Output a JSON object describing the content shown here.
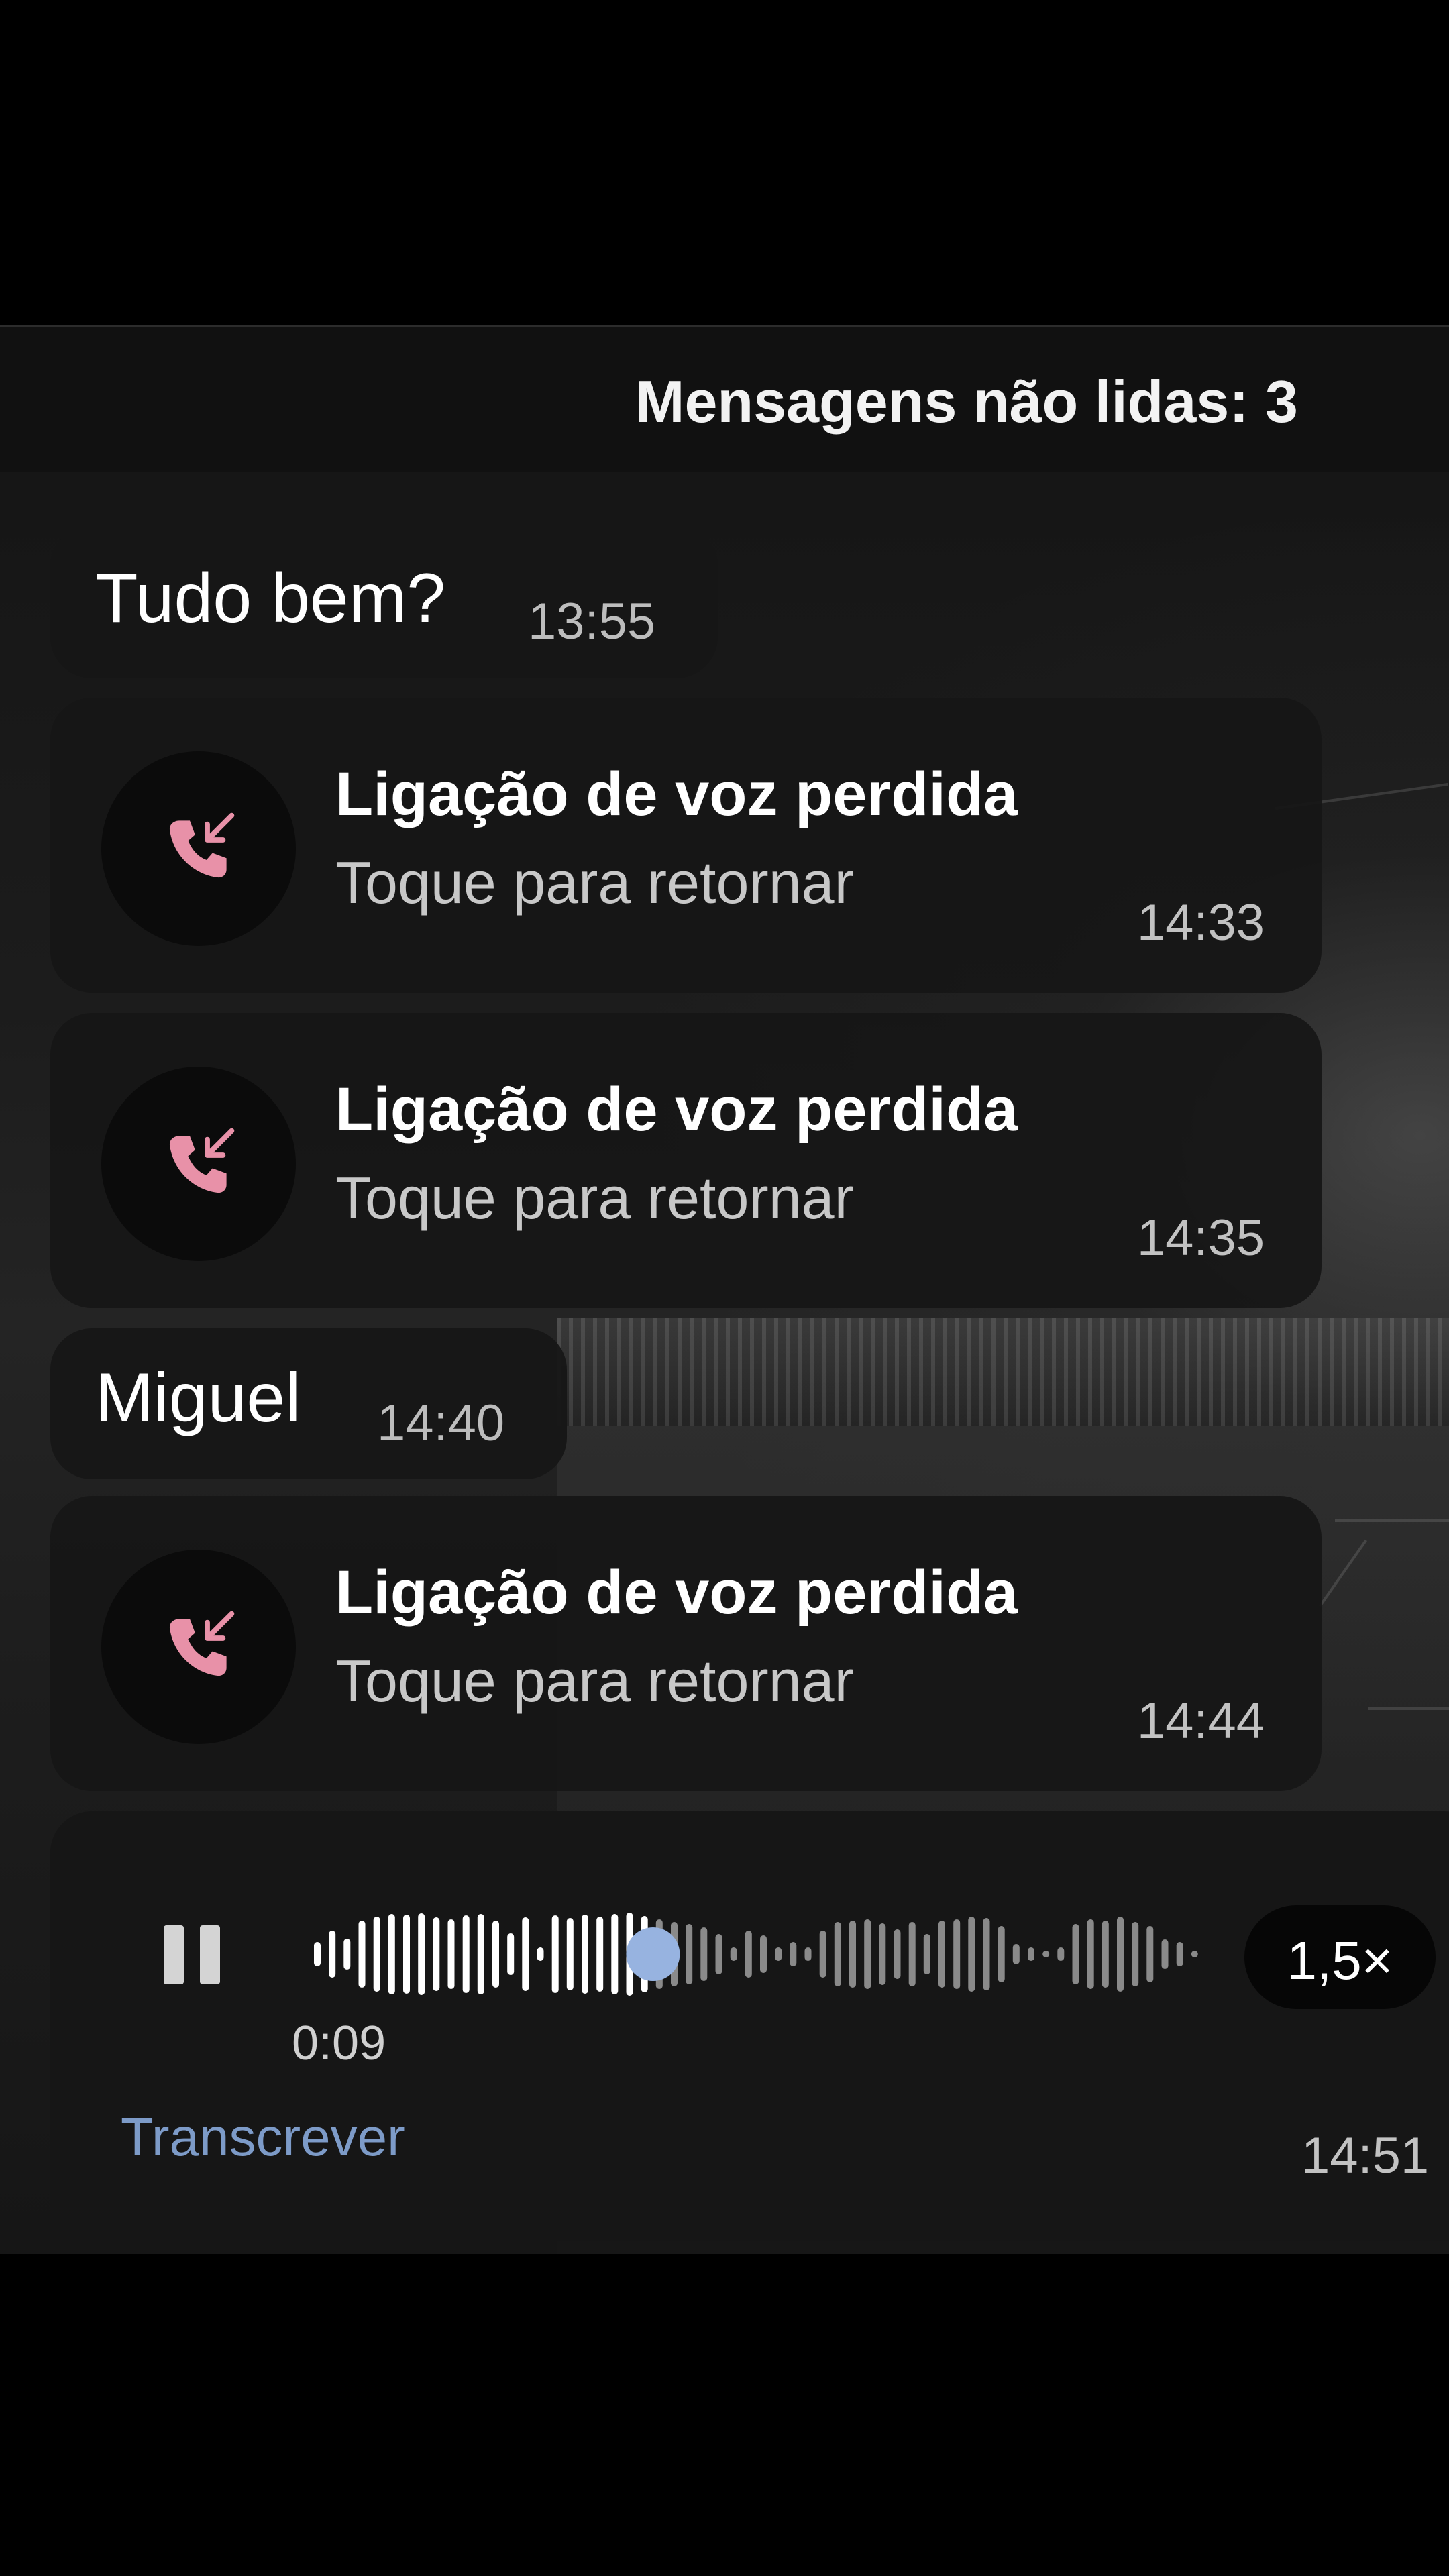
{
  "unread_banner": {
    "text": "Mensagens não lidas: 3"
  },
  "messages": {
    "text1": {
      "text": "Tudo bem?",
      "time": "13:55"
    },
    "call1": {
      "title": "Ligação de voz perdida",
      "subtitle": "Toque para retornar",
      "time": "14:33"
    },
    "call2": {
      "title": "Ligação de voz perdida",
      "subtitle": "Toque para retornar",
      "time": "14:35"
    },
    "text2": {
      "text": "Miguel",
      "time": "14:40"
    },
    "call3": {
      "title": "Ligação de voz perdida",
      "subtitle": "Toque para retornar",
      "time": "14:44"
    },
    "voice": {
      "duration": "0:09",
      "speed": "1,5×",
      "transcribe_label": "Transcrever",
      "time": "14:51",
      "progress": 0.38,
      "state": "playing"
    }
  },
  "icons": {
    "call": "missed-call-incoming-icon",
    "pause": "pause-icon"
  },
  "colors": {
    "missed_call_icon": "#e891a8",
    "played_wave": "#ffffff",
    "unplayed_wave": "#8a8a8a",
    "scrubber": "#97b3e0",
    "link": "#7d9bc8"
  }
}
